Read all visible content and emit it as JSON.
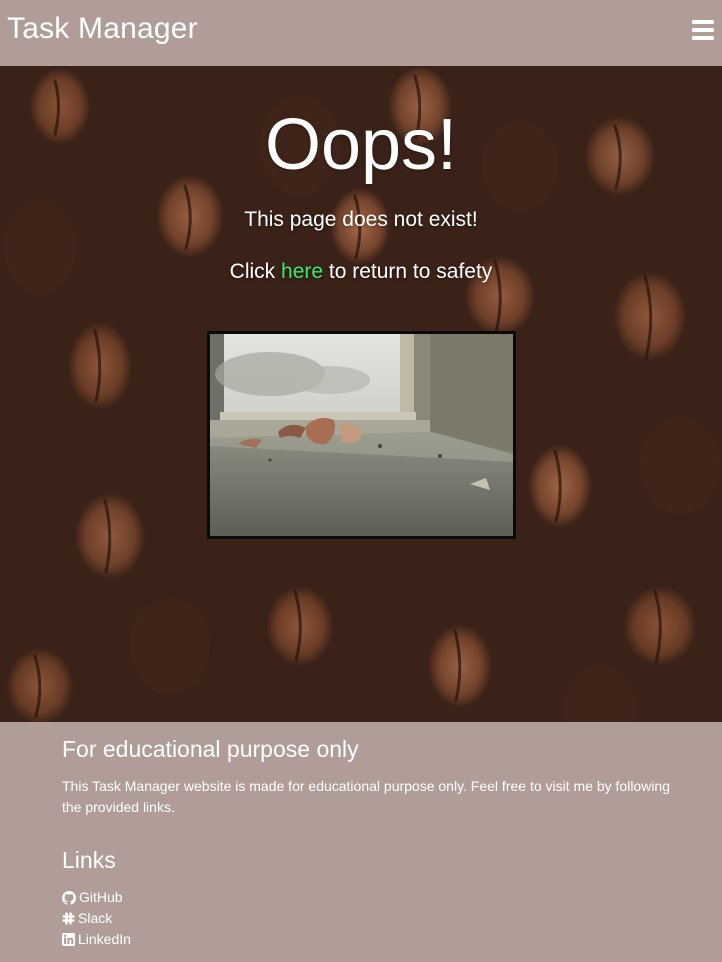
{
  "navbar": {
    "brand": "Task Manager",
    "menu_icon": "hamburger-icon"
  },
  "hero": {
    "title": "Oops!",
    "subtitle": "This page does not exist!",
    "return_prefix": "Click",
    "return_link": "here",
    "return_suffix": "to return to safety",
    "background": "coffee-beans-photo",
    "image": "broken-cup-on-windowsill-photo"
  },
  "footer": {
    "edu_title": "For educational purpose only",
    "edu_text": "This Task Manager website is made for educational purpose only. Feel free to visit me by following the provided links.",
    "links_title": "Links",
    "links": [
      {
        "label": "GitHub",
        "icon": "github-icon"
      },
      {
        "label": "Slack",
        "icon": "slack-icon"
      },
      {
        "label": "LinkedIn",
        "icon": "linkedin-icon"
      }
    ]
  },
  "colors": {
    "nav_footer_bg": "#b09d98",
    "link_accent": "#3ee86a",
    "text": "#ffffff"
  }
}
